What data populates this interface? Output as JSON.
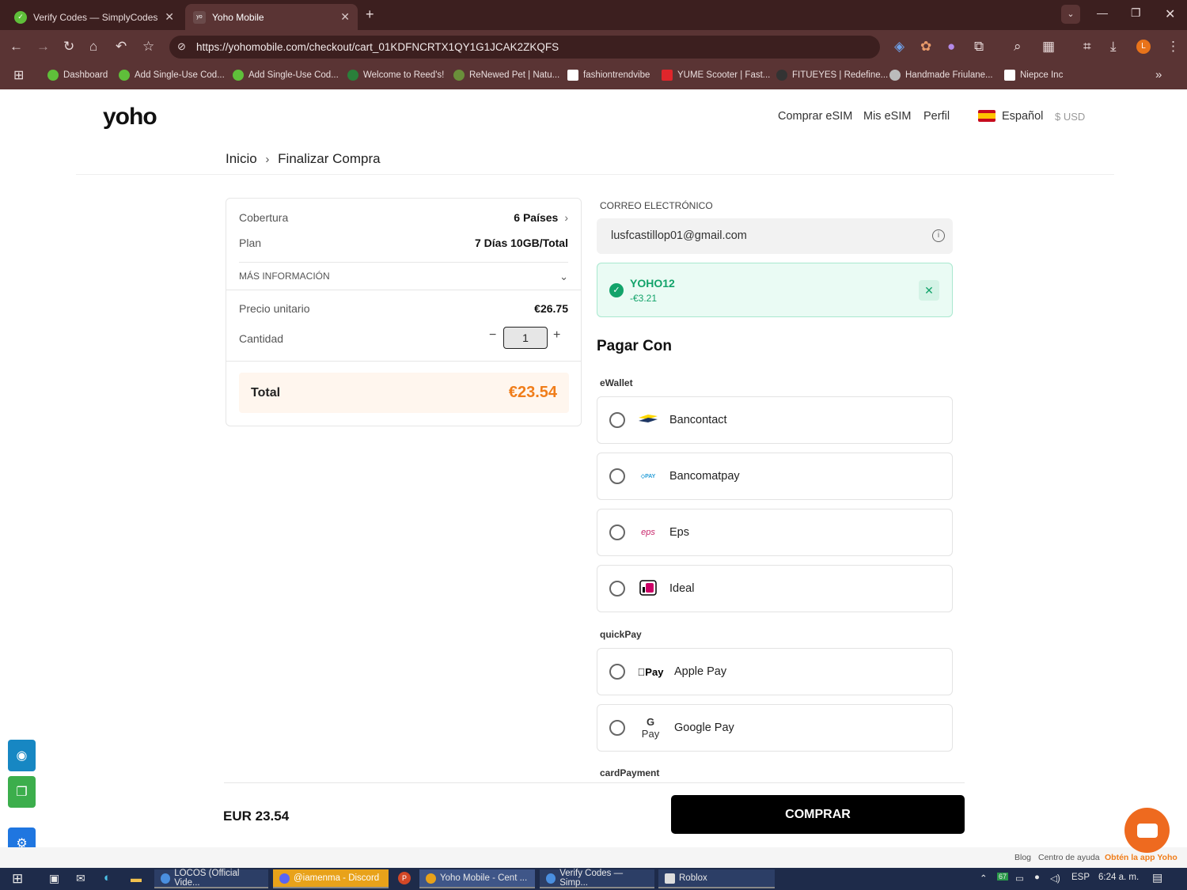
{
  "browser": {
    "tabs": [
      {
        "title": "Verify Codes — SimplyCodes",
        "active": false
      },
      {
        "title": "Yoho Mobile",
        "active": true
      }
    ],
    "url": "https://yohomobile.com/checkout/cart_01KDFNCRTX1QY1G1JCAK2ZKQFS",
    "profile_initial": "L",
    "bookmarks": [
      {
        "label": "Dashboard",
        "color": "#5fbf3a"
      },
      {
        "label": "Add Single-Use Cod...",
        "color": "#5fbf3a"
      },
      {
        "label": "Add Single-Use Cod...",
        "color": "#5fbf3a"
      },
      {
        "label": "Welcome to Reed's!",
        "color": "#2a7f3a"
      },
      {
        "label": "ReNewed Pet | Natu...",
        "color": "#6a8f3a"
      },
      {
        "label": "fashiontrendvibe",
        "color": "#ffffff"
      },
      {
        "label": "YUME Scooter | Fast...",
        "color": "#e0262b"
      },
      {
        "label": "FITUEYES | Redefine...",
        "color": "#333333"
      },
      {
        "label": "Handmade Friulane...",
        "color": "#bbbbbb"
      },
      {
        "label": "Niepce Inc",
        "color": "#ffffff"
      }
    ]
  },
  "site": {
    "logo": "yoho",
    "nav": [
      "Comprar eSIM",
      "Mis eSIM",
      "Perfil"
    ],
    "language": "Español",
    "currency": "$ USD",
    "breadcrumb": {
      "home": "Inicio",
      "current": "Finalizar Compra"
    }
  },
  "summary": {
    "coverage_label": "Cobertura",
    "coverage_value": "6 Países",
    "plan_label": "Plan",
    "plan_value": "7 Días 10GB/Total",
    "more_info": "MÁS INFORMACIÓN",
    "unit_price_label": "Precio unitario",
    "unit_price_value": "€26.75",
    "quantity_label": "Cantidad",
    "quantity_value": "1",
    "total_label": "Total",
    "total_value": "€23.54"
  },
  "checkout": {
    "email_label": "CORREO ELECTRÓNICO",
    "email_value": "lusfcastillop01@gmail.com",
    "promo_code": "YOHO12",
    "promo_discount": "-€3.21",
    "pay_with": "Pagar Con",
    "groups": {
      "ewallet": "eWallet",
      "quickpay": "quickPay",
      "card": "cardPayment"
    },
    "ewallet_options": [
      "Bancontact",
      "Bancomatpay",
      "Eps",
      "Ideal"
    ],
    "quickpay_options": [
      "Apple Pay",
      "Google Pay"
    ],
    "logos": {
      "apple": "Pay",
      "google": "Pay",
      "eps": "eps",
      "bancomat": "PAY"
    }
  },
  "bottom": {
    "amount": "EUR 23.54",
    "buy_label": "COMPRAR"
  },
  "footer": {
    "blog": "Blog",
    "help": "Centro de ayuda",
    "app": "Obtén la app Yoho"
  },
  "taskbar": {
    "items": [
      "LOCOS (Official Vide...",
      "@iamenma - Discord",
      "Yoho Mobile - Cent ...",
      "Verify Codes — Simp...",
      "Roblox"
    ],
    "badge": "67",
    "lang": "ESP",
    "time": "6:24 a. m."
  },
  "colors": {
    "accent_orange": "#f07d1a",
    "success_green": "#12a36a",
    "titlebar": "#3c1f1f"
  }
}
